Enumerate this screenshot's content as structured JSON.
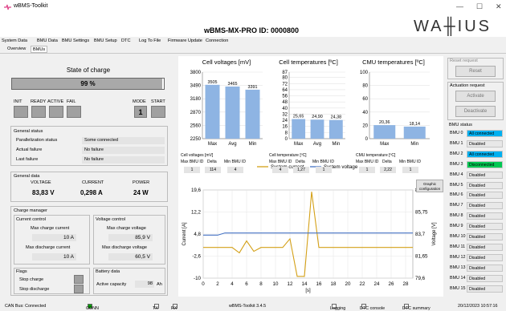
{
  "window": {
    "title": "wBMS-Toolkit",
    "minimize_glyph": "—",
    "maximize_glyph": "☐",
    "close_glyph": "✕"
  },
  "header": {
    "device_title": "wBMS-MX-PRO ID: 0000800",
    "logo_text": "WA╫IUS"
  },
  "menu_tabs": [
    "System Data",
    "BMU Data",
    "BMU Settings",
    "BMU Setup",
    "DTC",
    "Log To File",
    "Firmware Update",
    "Connection"
  ],
  "sub_tabs": [
    "Overview",
    "BMUs"
  ],
  "soc": {
    "title": "State of charge",
    "value": "99 %",
    "fill": 0.99
  },
  "flags": {
    "init": "INIT",
    "ready": "READY",
    "active": "ACTIVE",
    "fail": "FAIL",
    "mode": "MODE",
    "start": "START",
    "mode_value": "1"
  },
  "general_status": {
    "title": "General status",
    "rows": [
      {
        "label": "Parallelization status",
        "value": "Some connected"
      },
      {
        "label": "Actual failure",
        "value": "No failure"
      },
      {
        "label": "Last failure",
        "value": "No failure"
      }
    ]
  },
  "general_data": {
    "title": "General data",
    "voltage_label": "VOLTAGE",
    "voltage_value": "83,83 V",
    "current_label": "CURRENT",
    "current_value": "0,298 A",
    "power_label": "POWER",
    "power_value": "24 W"
  },
  "charge_manager": {
    "title": "Charge manager",
    "current_control": "Current control",
    "max_charge_current": "Max charge current",
    "max_charge_current_value": "10",
    "max_charge_current_unit": "A",
    "max_discharge_current": "Max discharge current",
    "max_discharge_current_value": "10",
    "max_discharge_current_unit": "A",
    "voltage_control": "Voltage control",
    "max_charge_voltage": "Max charge voltage",
    "max_charge_voltage_value": "85,9",
    "max_charge_voltage_unit": "V",
    "max_discharge_voltage": "Max discharge voltage",
    "max_discharge_voltage_value": "60,5",
    "max_discharge_voltage_unit": "V"
  },
  "flags_box": {
    "title": "Flags",
    "stop_charge": "Stop charge",
    "stop_discharge": "Stop discharge"
  },
  "battery_data": {
    "title": "Battery data",
    "active_capacity": "Active capacity",
    "active_capacity_value": "98",
    "active_capacity_unit": "Ah"
  },
  "reset_request": {
    "title": "Reset request",
    "button": "Reset"
  },
  "actuation_request": {
    "title": "Actuation request",
    "activate": "Activate",
    "deactivate": "Deactivate"
  },
  "bmu_status": {
    "title": "BMU status",
    "items": [
      {
        "name": "BMU 0",
        "status": "All connected",
        "color": "#00b0f0"
      },
      {
        "name": "BMU 1",
        "status": "Disabled",
        "color": "#e8e8e8"
      },
      {
        "name": "BMU 2",
        "status": "All connected",
        "color": "#00b0f0"
      },
      {
        "name": "BMU 3",
        "status": "Disconnected",
        "color": "#00c853"
      },
      {
        "name": "BMU 4",
        "status": "Disabled",
        "color": "#e8e8e8"
      },
      {
        "name": "BMU 5",
        "status": "Disabled",
        "color": "#e8e8e8"
      },
      {
        "name": "BMU 6",
        "status": "Disabled",
        "color": "#e8e8e8"
      },
      {
        "name": "BMU 7",
        "status": "Disabled",
        "color": "#e8e8e8"
      },
      {
        "name": "BMU 8",
        "status": "Disabled",
        "color": "#e8e8e8"
      },
      {
        "name": "BMU 9",
        "status": "Disabled",
        "color": "#e8e8e8"
      },
      {
        "name": "BMU 10",
        "status": "Disabled",
        "color": "#e8e8e8"
      },
      {
        "name": "BMU 11",
        "status": "Disabled",
        "color": "#e8e8e8"
      },
      {
        "name": "BMU 12",
        "status": "Disabled",
        "color": "#e8e8e8"
      },
      {
        "name": "BMU 13",
        "status": "Disabled",
        "color": "#e8e8e8"
      },
      {
        "name": "BMU 14",
        "status": "Disabled",
        "color": "#e8e8e8"
      },
      {
        "name": "BMU 15",
        "status": "Disabled",
        "color": "#e8e8e8"
      }
    ]
  },
  "graphic_configuration": "Graphic configuration",
  "cell_voltage_table": {
    "title": "Cell voltages [mV]",
    "headers": [
      "Max BMU ID",
      "Delta",
      "Min BMU ID"
    ],
    "values": [
      "1",
      "114",
      "4"
    ]
  },
  "cell_temp_table": {
    "title": "Cell temperature [ºC]",
    "headers": [
      "Max BMU ID",
      "Delta",
      "Min BMU ID"
    ],
    "values": [
      "4",
      "1,27",
      "1"
    ]
  },
  "cmu_temp_table": {
    "title": "CMU temperature [ºC]",
    "headers": [
      "Max BMU ID",
      "Delta",
      "Min BMU ID"
    ],
    "values": [
      "1",
      "2,22",
      "1"
    ]
  },
  "statusbar": {
    "can_bus": "CAN Bus: Connected",
    "conn": "CONN",
    "tx": "TX",
    "rx": "RX",
    "version": "wBMS-Toolkit 3.4.5",
    "logging": "Logging",
    "dtc_console": "DTC console",
    "dtc_summary": "DTC summary",
    "datetime": "20/12/2023 10:57:16"
  },
  "chart_data": [
    {
      "type": "bar",
      "title": "Cell voltages [mV]",
      "categories": [
        "Max",
        "Avg",
        "Min"
      ],
      "values": [
        3505,
        3465,
        3391
      ],
      "data_labels": [
        "3505",
        "3465",
        "3391"
      ],
      "ylim": [
        2250,
        3800
      ],
      "yticks": [
        2250,
        2560,
        2870,
        3180,
        3490,
        3800
      ],
      "color": "#8eb4e3"
    },
    {
      "type": "bar",
      "title": "Cell temperatures [ºC]",
      "categories": [
        "Max",
        "Avg",
        "Min"
      ],
      "values": [
        25.65,
        24.9,
        24.38
      ],
      "data_labels": [
        "25,65",
        "24,90",
        "24,38"
      ],
      "ylim": [
        0,
        87
      ],
      "yticks": [
        0,
        8,
        16,
        24,
        32,
        40,
        48,
        56,
        64,
        72,
        80,
        87
      ],
      "color": "#8eb4e3"
    },
    {
      "type": "bar",
      "title": "CMU temperatures [ºC]",
      "categories": [
        "Max",
        "Min"
      ],
      "values": [
        20.36,
        18.14
      ],
      "data_labels": [
        "20,36",
        "18,14"
      ],
      "ylim": [
        0,
        100
      ],
      "yticks": [
        0,
        20,
        40,
        60,
        80,
        100
      ],
      "color": "#8eb4e3"
    },
    {
      "type": "line",
      "xlabel": "[s]",
      "ylabel_left": "Current [A]",
      "ylabel_right": "Voltage [V]",
      "xlim": [
        0,
        29
      ],
      "ylim_left": [
        -10,
        19.6
      ],
      "ylim_right": [
        79.6,
        87.8
      ],
      "xticks": [
        0,
        2,
        4,
        6,
        8,
        10,
        12,
        14,
        16,
        18,
        20,
        22,
        24,
        26,
        28
      ],
      "yticks_left": [
        "19,6",
        "12,2",
        "4,8",
        "-2,6",
        "-10"
      ],
      "yticks_left_values": [
        19.6,
        12.2,
        4.8,
        -2.6,
        -10
      ],
      "yticks_right": [
        "87,8",
        "85,75",
        "83,7",
        "81,65",
        "79,6"
      ],
      "yticks_right_values": [
        87.8,
        85.75,
        83.7,
        81.65,
        79.6
      ],
      "series": [
        {
          "name": "System current",
          "axis": "left",
          "color": "#d4a017",
          "x": [
            0,
            1,
            2,
            3,
            4,
            5,
            6,
            7,
            8,
            9,
            10,
            11,
            12,
            13,
            14,
            15,
            16,
            17,
            18,
            19,
            20,
            21,
            22,
            23,
            24,
            25,
            26,
            27,
            28,
            29
          ],
          "y": [
            0.3,
            0.3,
            0.3,
            0.3,
            0.3,
            -1.5,
            2.5,
            -1.0,
            0.3,
            0.3,
            0.3,
            0.3,
            3.2,
            -9.4,
            -9.4,
            19.0,
            0.3,
            0.3,
            0.3,
            0.3,
            0.3,
            0.3,
            0.3,
            0.3,
            0.3,
            0.3,
            0.3,
            0.3,
            0.3,
            0.3
          ]
        },
        {
          "name": "System voltage",
          "axis": "right",
          "color": "#4472c4",
          "x": [
            0,
            1,
            2,
            3,
            4,
            5,
            6,
            7,
            8,
            9,
            10,
            11,
            12,
            13,
            14,
            15,
            16,
            17,
            18,
            19,
            20,
            21,
            22,
            23,
            24,
            25,
            26,
            27,
            28,
            29
          ],
          "y": [
            83.6,
            83.6,
            83.6,
            83.8,
            83.8,
            83.8,
            83.8,
            83.8,
            83.8,
            83.8,
            83.8,
            83.8,
            83.8,
            83.8,
            83.8,
            83.8,
            83.8,
            83.8,
            83.8,
            83.8,
            83.8,
            83.8,
            83.8,
            83.8,
            83.8,
            83.8,
            83.8,
            83.8,
            83.8,
            83.8
          ]
        }
      ]
    }
  ]
}
